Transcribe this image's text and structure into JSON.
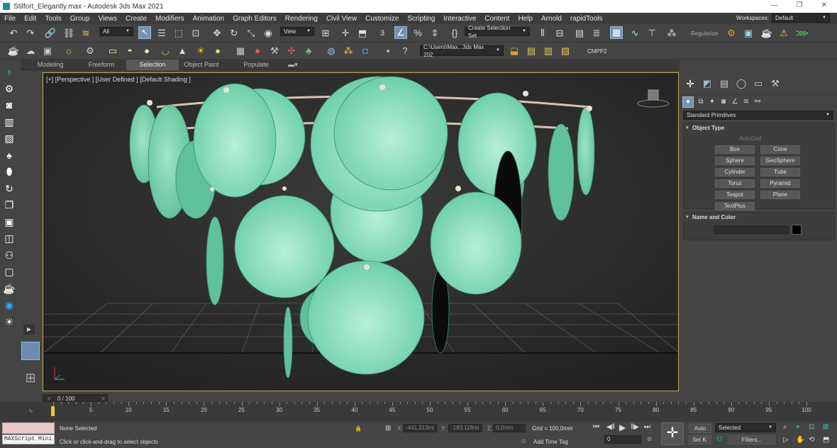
{
  "window": {
    "title": "Stilfort_Elegantly.max - Autodesk 3ds Max 2021",
    "buttons": [
      "—",
      "❐",
      "✕"
    ]
  },
  "menu": [
    "File",
    "Edit",
    "Tools",
    "Group",
    "Views",
    "Create",
    "Modifiers",
    "Animation",
    "Graph Editors",
    "Rendering",
    "Civil View",
    "Customize",
    "Scripting",
    "Interactive",
    "Content",
    "Help",
    "Arnold",
    "rapidTools"
  ],
  "workspaces": {
    "label": "Workspaces:",
    "value": "Default"
  },
  "toolbar": {
    "filter": "All",
    "view": "View",
    "selection_set": "Create Selection Set",
    "regularize": "Regularize"
  },
  "toolbar2": {
    "path": "C:\\Users\\Max...3ds Max 202",
    "plugin": "CMPP2"
  },
  "ribbon": {
    "tabs": [
      "Modeling",
      "Freeform",
      "Selection",
      "Object Paint",
      "Populate"
    ],
    "active": "Selection"
  },
  "viewport": {
    "label": "[+] [Perspective ] [User Defined ] [Default Shading ]"
  },
  "command_panel": {
    "category": "Standard Primitives",
    "object_type": {
      "title": "Object Type",
      "autogrid": "AutoGrid",
      "buttons": [
        "Box",
        "Cone",
        "Sphere",
        "GeoSphere",
        "Cylinder",
        "Tube",
        "Torus",
        "Pyramid",
        "Teapot",
        "Plane",
        "TextPlus"
      ]
    },
    "name_color": {
      "title": "Name and Color",
      "color": "#000000"
    }
  },
  "timeline": {
    "counter": "0 / 100",
    "ticks": [
      5,
      10,
      15,
      20,
      25,
      30,
      35,
      40,
      45,
      50,
      55,
      60,
      65,
      70,
      75,
      80,
      85,
      90,
      95,
      100
    ]
  },
  "status": {
    "maxscript": "MAXScript Mini",
    "selection": "None Selected",
    "prompt": "Click or click-and-drag to select objects",
    "x_label": "X:",
    "x": "-441,313mi",
    "y_label": "Y:",
    "y": "-183,118mi",
    "z_label": "Z:",
    "z": "0,0mm",
    "grid": "Grid = 100,0mm",
    "add_time_tag": "Add Time Tag",
    "auto": "Auto",
    "set_key": "Set K.",
    "key_mode": "Selected",
    "filters": "Filters...",
    "frame": "0"
  }
}
